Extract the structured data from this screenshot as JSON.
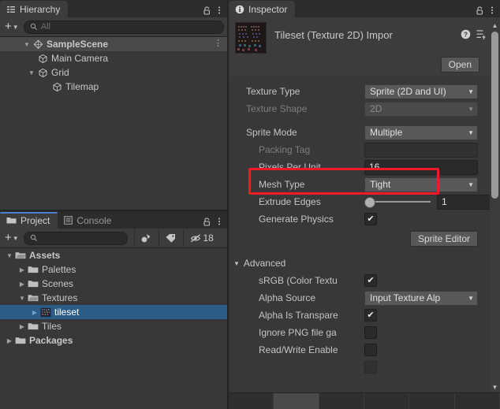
{
  "hierarchy": {
    "tab_label": "Hierarchy",
    "tab_icon": "hierarchy-icon",
    "lock_icon": "lock-open-icon",
    "menu_icon": "kebab-menu-icon",
    "add_label": "+",
    "search_placeholder": "All",
    "search_value": "",
    "rows": [
      {
        "label": "SampleScene",
        "indent": 1,
        "arrow": "down",
        "glyph": "scene-icon",
        "bold": true,
        "state": "highlight",
        "menu": true
      },
      {
        "label": "Main Camera",
        "indent": 2,
        "arrow": "none",
        "glyph": "gameobject-icon",
        "bold": false,
        "state": "normal",
        "menu": false
      },
      {
        "label": "Grid",
        "indent": 2,
        "arrow": "down",
        "glyph": "gameobject-icon",
        "bold": false,
        "state": "normal",
        "menu": false
      },
      {
        "label": "Tilemap",
        "indent": 3,
        "arrow": "none",
        "glyph": "gameobject-icon",
        "bold": false,
        "state": "normal",
        "menu": false
      }
    ]
  },
  "project": {
    "tabs": [
      {
        "label": "Project",
        "icon": "folder-icon",
        "active": true
      },
      {
        "label": "Console",
        "icon": "console-icon",
        "active": false
      }
    ],
    "lock_icon": "lock-open-icon",
    "menu_icon": "kebab-menu-icon",
    "add_label": "+",
    "search_placeholder": "",
    "search_value": "",
    "toolbar_icons": [
      "asset-filter-icon",
      "label-filter-icon",
      "hidden-packages-icon"
    ],
    "hidden_count": "18",
    "rows": [
      {
        "label": "Assets",
        "indent": 0,
        "arrow": "down",
        "glyph": "folder-open-icon",
        "bold": true,
        "state": "normal"
      },
      {
        "label": "Palettes",
        "indent": 1,
        "arrow": "right",
        "glyph": "folder-icon",
        "bold": false,
        "state": "normal"
      },
      {
        "label": "Scenes",
        "indent": 1,
        "arrow": "right",
        "glyph": "folder-icon",
        "bold": false,
        "state": "normal"
      },
      {
        "label": "Textures",
        "indent": 1,
        "arrow": "down",
        "glyph": "folder-open-icon",
        "bold": false,
        "state": "normal"
      },
      {
        "label": "tileset",
        "indent": 2,
        "arrow": "right",
        "glyph": "texture-icon",
        "bold": false,
        "state": "selected"
      },
      {
        "label": "Tiles",
        "indent": 1,
        "arrow": "right",
        "glyph": "folder-icon",
        "bold": false,
        "state": "normal"
      },
      {
        "label": "Packages",
        "indent": 0,
        "arrow": "right",
        "glyph": "folder-icon",
        "bold": true,
        "state": "normal"
      }
    ]
  },
  "inspector": {
    "tab_label": "Inspector",
    "tab_icon": "info-icon",
    "lock_icon": "lock-open-icon",
    "menu_icon": "kebab-menu-icon",
    "asset_title": "Tileset (Texture 2D) Impor",
    "asset_thumb_icon": "tileset-thumbnail",
    "help_icon": "help-icon",
    "preset_icon": "preset-icon",
    "more_icon": "kebab-menu-icon",
    "open_button": "Open",
    "sprite_editor_button": "Sprite Editor",
    "fields": [
      {
        "kind": "dropdown",
        "label": "Texture Type",
        "value": "Sprite (2D and UI)",
        "disabled": false,
        "indent": 0
      },
      {
        "kind": "dropdown",
        "label": "Texture Shape",
        "value": "2D",
        "disabled": true,
        "indent": 0
      },
      {
        "kind": "spacer"
      },
      {
        "kind": "dropdown",
        "label": "Sprite Mode",
        "value": "Multiple",
        "disabled": false,
        "indent": 0
      },
      {
        "kind": "text",
        "label": "Packing Tag",
        "value": "",
        "disabled": true,
        "indent": 1
      },
      {
        "kind": "text",
        "label": "Pixels Per Unit",
        "value": "16",
        "disabled": false,
        "indent": 1,
        "highlighted": true
      },
      {
        "kind": "dropdown",
        "label": "Mesh Type",
        "value": "Tight",
        "disabled": false,
        "indent": 1
      },
      {
        "kind": "slider",
        "label": "Extrude Edges",
        "value": "1",
        "disabled": false,
        "indent": 1
      },
      {
        "kind": "check",
        "label": "Generate Physics",
        "value": true,
        "disabled": false,
        "indent": 1
      }
    ],
    "advanced": {
      "label": "Advanced",
      "expanded": true,
      "fields": [
        {
          "kind": "check",
          "label": "sRGB (Color Textu",
          "value": true
        },
        {
          "kind": "dropdown",
          "label": "Alpha Source",
          "value": "Input Texture Alp"
        },
        {
          "kind": "check",
          "label": "Alpha Is Transpare",
          "value": true
        },
        {
          "kind": "check",
          "label": "Ignore PNG file ga",
          "value": false
        },
        {
          "kind": "check",
          "label": "Read/Write Enable",
          "value": false
        }
      ]
    },
    "scroll_up_icon": "scroll-up-arrow",
    "scroll_down_icon": "scroll-down-arrow"
  },
  "annotation": {
    "color": "#ee1b24",
    "target": "Pixels Per Unit"
  }
}
